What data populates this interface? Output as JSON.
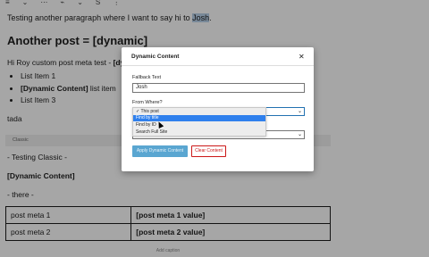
{
  "editor": {
    "toolbar_icons": [
      "align-icon",
      "chevron-icon",
      "more-icon",
      "link-icon",
      "dropdown-icon",
      "strike-icon",
      "chevron-icon",
      "more-vertical-icon"
    ],
    "paragraph1_before": "Testing another paragraph where I want to say hi to ",
    "paragraph1_highlight": "Josh",
    "paragraph1_after": ".",
    "heading": "Another post = [dynamic]",
    "paragraph2_before": "Hi Roy custom post meta test - ",
    "paragraph2_bold": "[dynar",
    "list": [
      {
        "bold": "",
        "text": "List Item 1"
      },
      {
        "bold": "[Dynamic Content]",
        "text": " list item"
      },
      {
        "bold": "",
        "text": "List Item 3"
      }
    ],
    "tada": "tada",
    "classic_label": "Classic",
    "testing_classic": "- Testing Classic -",
    "dynamic_content": "[Dynamic Content]",
    "there": "- there -",
    "table": [
      {
        "key": "post meta 1",
        "value": "[post meta 1 value]"
      },
      {
        "key": "post meta 2",
        "value": "[post meta 2 value]"
      }
    ],
    "caption": "Add caption"
  },
  "modal": {
    "title": "Dynamic Content",
    "close": "✕",
    "fallback_label": "Fallback Text",
    "fallback_value": "Josh",
    "from_where_label": "From Where?",
    "apply_button": "Apply Dynamic Content",
    "clear_button": "Clear Content"
  },
  "dropdown": {
    "options": [
      {
        "label": "✓ This post",
        "selected": false
      },
      {
        "label": "Find by title",
        "selected": true
      },
      {
        "label": "Find by ID",
        "selected": false
      },
      {
        "label": "Search Full Site",
        "selected": false
      }
    ]
  },
  "colors": {
    "accent": "#2f80ed",
    "apply": "#5aa6d1",
    "danger": "#cc1818",
    "highlight": "#b9d2ea"
  }
}
